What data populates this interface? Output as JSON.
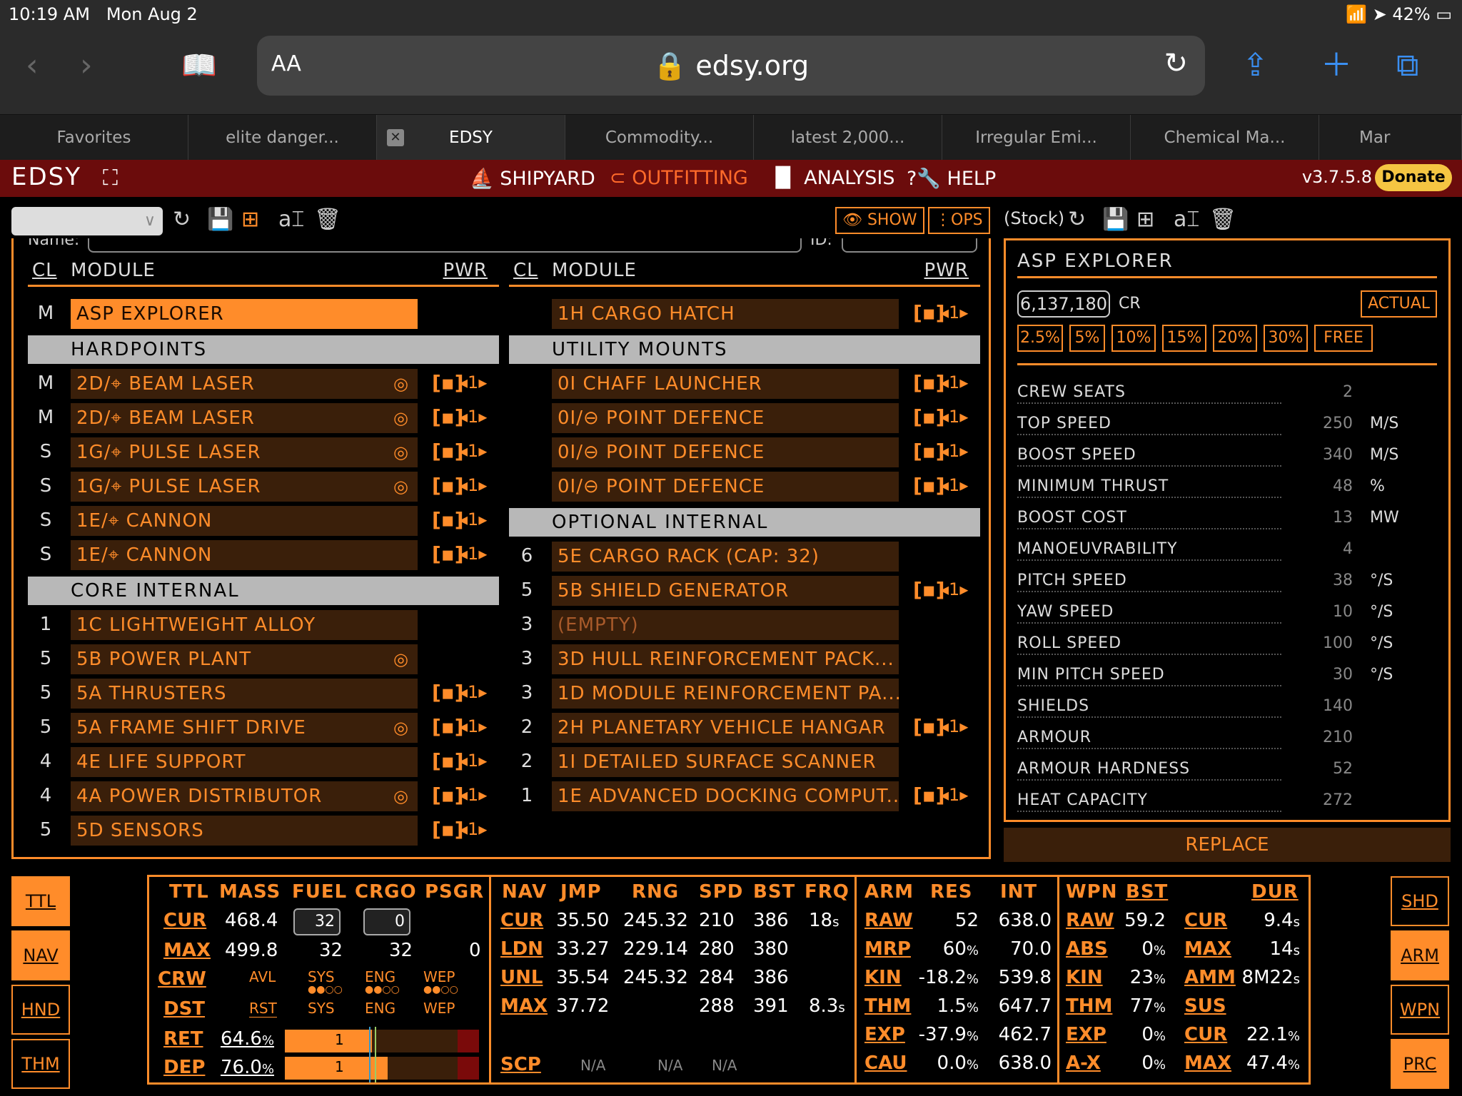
{
  "status": {
    "time": "10:19 AM",
    "date": "Mon Aug 2",
    "battery": "42%"
  },
  "browser": {
    "aa": "AA",
    "url": "edsy.org",
    "tabs": [
      "Favorites",
      "elite danger...",
      "EDSY",
      "Commodity...",
      "latest 2,000...",
      "Irregular Emi...",
      "Chemical Ma...",
      "Mar"
    ]
  },
  "app": {
    "logo": "EDSY",
    "version": "v3.7.5.8",
    "donate": "Donate",
    "menu": {
      "shipyard": "SHIPYARD",
      "outfitting": "OUTFITTING",
      "analysis": "ANALYSIS",
      "help": "HELP"
    },
    "show": "SHOW",
    "ops": "OPS",
    "stock": "(Stock)",
    "name_label": "Name:",
    "id_label": "ID:"
  },
  "table_headers": {
    "cl": "CL",
    "module": "MODULE",
    "pwr": "PWR"
  },
  "ship_row": {
    "cls": "M",
    "name": "ASP EXPLORER"
  },
  "cargo_hatch": {
    "name": "1H CARGO HATCH"
  },
  "sections": {
    "hardpoints": "HARDPOINTS",
    "core": "CORE INTERNAL",
    "utility": "UTILITY MOUNTS",
    "optional": "OPTIONAL INTERNAL"
  },
  "hardpoints": [
    {
      "cls": "M",
      "name": "2D/⌖ BEAM LASER",
      "eng": true,
      "pwr": true
    },
    {
      "cls": "M",
      "name": "2D/⌖ BEAM LASER",
      "eng": true,
      "pwr": true
    },
    {
      "cls": "S",
      "name": "1G/⌖ PULSE LASER",
      "eng": true,
      "pwr": true
    },
    {
      "cls": "S",
      "name": "1G/⌖ PULSE LASER",
      "eng": true,
      "pwr": true
    },
    {
      "cls": "S",
      "name": "1E/⌖ CANNON",
      "eng": false,
      "pwr": true
    },
    {
      "cls": "S",
      "name": "1E/⌖ CANNON",
      "eng": false,
      "pwr": true
    }
  ],
  "core": [
    {
      "cls": "1",
      "name": "1C LIGHTWEIGHT ALLOY",
      "eng": false,
      "pwr": false
    },
    {
      "cls": "5",
      "name": "5B POWER PLANT",
      "eng": true,
      "pwr": false
    },
    {
      "cls": "5",
      "name": "5A THRUSTERS",
      "eng": false,
      "pwr": true
    },
    {
      "cls": "5",
      "name": "5A FRAME SHIFT DRIVE",
      "eng": true,
      "pwr": true
    },
    {
      "cls": "4",
      "name": "4E LIFE SUPPORT",
      "eng": false,
      "pwr": true
    },
    {
      "cls": "4",
      "name": "4A POWER DISTRIBUTOR",
      "eng": true,
      "pwr": true
    },
    {
      "cls": "5",
      "name": "5D SENSORS",
      "eng": false,
      "pwr": true
    }
  ],
  "utility": [
    {
      "cls": "",
      "name": "0I CHAFF LAUNCHER",
      "pwr": true
    },
    {
      "cls": "",
      "name": "0I/⊖ POINT DEFENCE",
      "pwr": true
    },
    {
      "cls": "",
      "name": "0I/⊖ POINT DEFENCE",
      "pwr": true
    },
    {
      "cls": "",
      "name": "0I/⊖ POINT DEFENCE",
      "pwr": true
    }
  ],
  "optional": [
    {
      "cls": "6",
      "name": "5E CARGO RACK (CAP: 32)",
      "pwr": false,
      "empty": false
    },
    {
      "cls": "5",
      "name": "5B SHIELD GENERATOR",
      "pwr": true,
      "empty": false
    },
    {
      "cls": "3",
      "name": "(EMPTY)",
      "pwr": false,
      "empty": true
    },
    {
      "cls": "3",
      "name": "3D HULL REINFORCEMENT PACK...",
      "pwr": false,
      "empty": false
    },
    {
      "cls": "3",
      "name": "1D MODULE REINFORCEMENT PA...",
      "pwr": false,
      "empty": false
    },
    {
      "cls": "2",
      "name": "2H PLANETARY VEHICLE HANGAR",
      "pwr": true,
      "empty": false
    },
    {
      "cls": "2",
      "name": "1I DETAILED SURFACE SCANNER",
      "pwr": false,
      "empty": false
    },
    {
      "cls": "1",
      "name": "1E ADVANCED DOCKING COMPUT...",
      "pwr": true,
      "empty": false
    }
  ],
  "pwr_glyph": "[▪]",
  "prio_glyph": "◂1▸",
  "eng_glyph": "◎",
  "right": {
    "title": "ASP EXPLORER",
    "cost": "6,137,180",
    "cr": "CR",
    "actual": "ACTUAL",
    "discounts": [
      "2.5%",
      "5%",
      "10%",
      "15%",
      "20%",
      "30%",
      "FREE"
    ],
    "stats": [
      {
        "label": "CREW SEATS",
        "value": "2",
        "unit": ""
      },
      {
        "label": "TOP SPEED",
        "value": "250",
        "unit": "M/S"
      },
      {
        "label": "BOOST SPEED",
        "value": "340",
        "unit": "M/S"
      },
      {
        "label": "MINIMUM THRUST",
        "value": "48",
        "unit": "%"
      },
      {
        "label": "BOOST COST",
        "value": "13",
        "unit": "MW"
      },
      {
        "label": "MANOEUVRABILITY",
        "value": "4",
        "unit": ""
      },
      {
        "label": "PITCH SPEED",
        "value": "38",
        "unit": "°/S"
      },
      {
        "label": "YAW SPEED",
        "value": "10",
        "unit": "°/S"
      },
      {
        "label": "ROLL SPEED",
        "value": "100",
        "unit": "°/S"
      },
      {
        "label": "MIN PITCH SPEED",
        "value": "30",
        "unit": "°/S"
      },
      {
        "label": "SHIELDS",
        "value": "140",
        "unit": ""
      },
      {
        "label": "ARMOUR",
        "value": "210",
        "unit": ""
      },
      {
        "label": "ARMOUR HARDNESS",
        "value": "52",
        "unit": ""
      },
      {
        "label": "HEAT CAPACITY",
        "value": "272",
        "unit": ""
      }
    ],
    "replace": "REPLACE"
  },
  "side_left": [
    "TTL",
    "NAV",
    "HND",
    "THM"
  ],
  "side_right": [
    "SHD",
    "ARM",
    "WPN",
    "PRC"
  ],
  "ttl": {
    "h": [
      "TTL",
      "MASS",
      "FUEL",
      "CRGO",
      "PSGR"
    ],
    "cur": {
      "l": "CUR",
      "mass": "468.4",
      "fuel": "32",
      "crgo": "0"
    },
    "max": {
      "l": "MAX",
      "mass": "499.8",
      "fuel": "32",
      "crgo": "32",
      "psgr": "0"
    },
    "crw": "CRW",
    "dst": "DST",
    "avl": "AVL",
    "rst": "RST",
    "sys": "SYS",
    "eng": "ENG",
    "wep": "WEP",
    "ret": {
      "l": "RET",
      "v": "64.6",
      "u": "%",
      "bar": "1",
      "fill": 0.45
    },
    "dep": {
      "l": "DEP",
      "v": "76.0",
      "u": "%",
      "bar": "1",
      "fill": 0.53
    }
  },
  "nav": {
    "h": [
      "NAV",
      "JMP",
      "RNG",
      "SPD",
      "BST",
      "FRQ"
    ],
    "rows": [
      {
        "l": "CUR",
        "jmp": "35.50",
        "rng": "245.32",
        "spd": "210",
        "bst": "386",
        "frq": "18",
        "fu": "s"
      },
      {
        "l": "LDN",
        "jmp": "33.27",
        "rng": "229.14",
        "spd": "280",
        "bst": "380",
        "frq": "",
        "fu": ""
      },
      {
        "l": "UNL",
        "jmp": "35.54",
        "rng": "245.32",
        "spd": "284",
        "bst": "386",
        "frq": "",
        "fu": ""
      },
      {
        "l": "MAX",
        "jmp": "37.72",
        "rng": "",
        "spd": "288",
        "bst": "391",
        "frq": "8.3",
        "fu": "s"
      }
    ],
    "scp": {
      "l": "SCP",
      "a": "N/A",
      "b": "N/A",
      "c": "N/A"
    }
  },
  "arm": {
    "h": [
      "ARM",
      "RES",
      "INT"
    ],
    "rows": [
      {
        "l": "RAW",
        "res": "52",
        "ru": "",
        "int": "638.0"
      },
      {
        "l": "MRP",
        "res": "60",
        "ru": "%",
        "int": "70.0"
      },
      {
        "l": "KIN",
        "res": "-18.2",
        "ru": "%",
        "int": "539.8"
      },
      {
        "l": "THM",
        "res": "1.5",
        "ru": "%",
        "int": "647.7"
      },
      {
        "l": "EXP",
        "res": "-37.9",
        "ru": "%",
        "int": "462.7"
      },
      {
        "l": "CAU",
        "res": "0.0",
        "ru": "%",
        "int": "638.0"
      }
    ]
  },
  "wpn": {
    "h": [
      "WPN",
      "BST",
      "DUR"
    ],
    "rows": [
      {
        "l": "RAW",
        "v": "59.2",
        "u": "",
        "l2": "CUR",
        "v2": "9.4",
        "u2": "s"
      },
      {
        "l": "ABS",
        "v": "0",
        "u": "%",
        "l2": "MAX",
        "v2": "14",
        "u2": "s"
      },
      {
        "l": "KIN",
        "v": "23",
        "u": "%",
        "l2": "AMM",
        "v2": "8M22",
        "u2": "s"
      },
      {
        "l": "THM",
        "v": "77",
        "u": "%",
        "l2": "SUS",
        "v2": "",
        "u2": ""
      },
      {
        "l": "EXP",
        "v": "0",
        "u": "%",
        "l2": "CUR",
        "v2": "22.1",
        "u2": "%"
      },
      {
        "l": "A-X",
        "v": "0",
        "u": "%",
        "l2": "MAX",
        "v2": "47.4",
        "u2": "%"
      }
    ]
  }
}
